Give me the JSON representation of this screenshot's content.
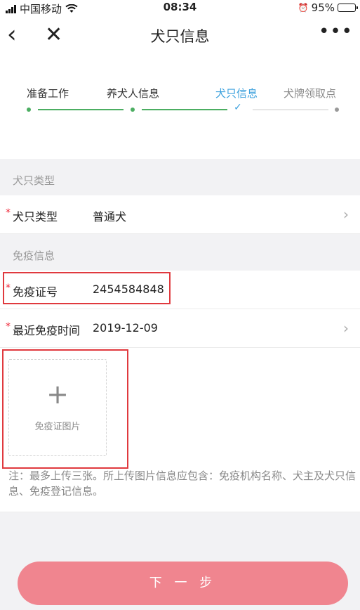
{
  "status_bar": {
    "carrier": "中国移动",
    "time": "08:34",
    "battery": "95%",
    "battery_level": 0.95
  },
  "nav": {
    "title": "犬只信息",
    "more": "•••"
  },
  "steps": [
    {
      "label": "准备工作",
      "state": "done"
    },
    {
      "label": "养犬人信息",
      "state": "done"
    },
    {
      "label": "犬只信息",
      "state": "active"
    },
    {
      "label": "犬牌领取点",
      "state": "pending"
    }
  ],
  "sections": {
    "dog_type_header": "犬只类型",
    "immunization_header": "免疫信息"
  },
  "fields": {
    "dog_type": {
      "required": "*",
      "label": "犬只类型",
      "value": "普通犬"
    },
    "immunization_cert_no": {
      "required": "*",
      "label": "免疫证号",
      "value": "2454584848"
    },
    "last_immunization_date": {
      "required": "*",
      "label": "最近免疫时间",
      "value": "2019-12-09"
    }
  },
  "upload": {
    "caption": "免疫证图片"
  },
  "note": "注：最多上传三张。所上传图片信息应包含：免疫机构名称、犬主及犬只信息、免疫登记信息。",
  "next_button": "下 一 步",
  "colors": {
    "accent": "#3aa0dd",
    "progress": "#4cae62",
    "primary_button": "#f0858f",
    "highlight": "#e0393e",
    "required": "#ee2233"
  }
}
